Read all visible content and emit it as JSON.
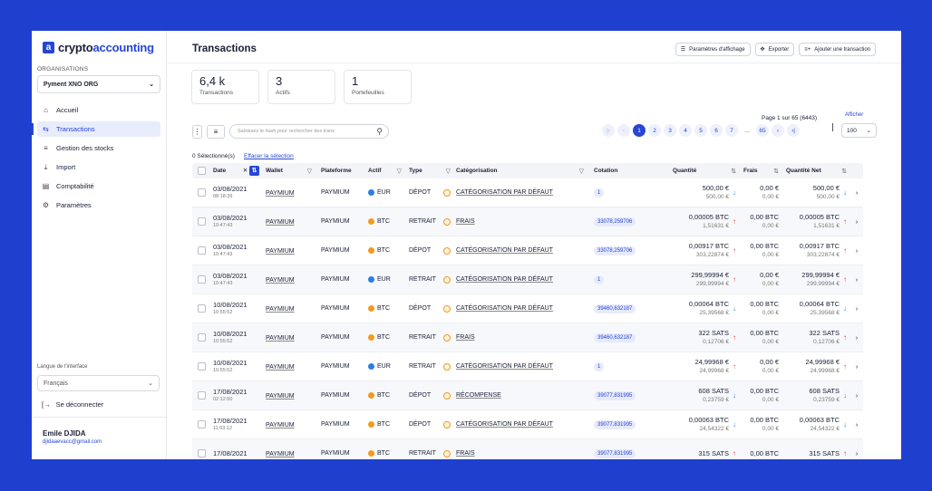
{
  "brand": {
    "logo_letter": "a",
    "name_prefix": "crypto",
    "name_suffix": "accounting",
    "accent": "#2746d6",
    "background": "#1f3fcf"
  },
  "sidebar": {
    "org_label": "ORGANISATIONS",
    "org_value": "Pyment XNO ORG",
    "items": [
      {
        "label": "Accueil",
        "icon": "home-icon",
        "glyph": "⌂",
        "active": false
      },
      {
        "label": "Transactions",
        "icon": "transactions-icon",
        "glyph": "⇆",
        "active": true
      },
      {
        "label": "Gestion des stocks",
        "icon": "stock-icon",
        "glyph": "≡",
        "active": false
      },
      {
        "label": "Import",
        "icon": "import-icon",
        "glyph": "⤓",
        "active": false
      },
      {
        "label": "Comptabilité",
        "icon": "document-icon",
        "glyph": "▤",
        "active": false
      },
      {
        "label": "Paramètres",
        "icon": "gear-icon",
        "glyph": "⚙",
        "active": false
      }
    ],
    "lang_label": "Langue de l'interface",
    "lang_value": "Français",
    "logout": "Se déconnecter",
    "user_name": "Emile DJIDA",
    "user_email": "djidaaevacc@gmail.com"
  },
  "header": {
    "title": "Transactions",
    "btn_display": "Paramètres d'affichage",
    "btn_export": "Exporter",
    "btn_add": "Ajouter une transaction"
  },
  "stats": [
    {
      "value": "6,4 k",
      "label": "Transactions"
    },
    {
      "value": "3",
      "label": "Actifs"
    },
    {
      "value": "1",
      "label": "Portefeuilles"
    }
  ],
  "toolbar": {
    "search_placeholder": "Saisissez le hash pour rechercher des trans"
  },
  "pager": {
    "pages": [
      "1",
      "2",
      "3",
      "4",
      "5",
      "6",
      "7",
      "...",
      "65"
    ],
    "current": "1",
    "info": "Page 1 sur 65 (6443)",
    "show_label": "Afficher",
    "show_value": "100"
  },
  "selection": {
    "count": "0 Sélectionné(s)",
    "clear": "Effacer la sélection"
  },
  "columns": {
    "date": "Date",
    "wallet": "Wallet",
    "platform": "Plateforme",
    "asset": "Actif",
    "type": "Type",
    "category": "Catégorisation",
    "quote": "Cotation",
    "qty": "Quantité",
    "fees": "Frais",
    "net": "Quantité Net"
  },
  "rows": [
    {
      "date": "03/08/2021",
      "time": "08:18:39",
      "wallet": "PAYMIUM",
      "platform": "PAYMIUM",
      "asset": "EUR",
      "coin": "eur",
      "type": "DÉPOT",
      "category": "CATÉGORISATION PAR DÉFAUT",
      "quote": "1",
      "qty": "500,00 €",
      "qty_sub": "500,00 €",
      "dir": "down",
      "fees": "0,00 €",
      "fees_sub": "0,00 €",
      "net": "500,00 €",
      "net_sub": "500,00 €"
    },
    {
      "date": "03/08/2021",
      "time": "10:47:43",
      "wallet": "PAYMIUM",
      "platform": "PAYMIUM",
      "asset": "BTC",
      "coin": "btc",
      "type": "RETRAIT",
      "category": "FRAIS",
      "quote": "33078,259706",
      "qty": "0,00005 BTC",
      "qty_sub": "1,51631 €",
      "dir": "up",
      "fees": "0,00 BTC",
      "fees_sub": "0,00 €",
      "net": "0,00005 BTC",
      "net_sub": "1,51631 €"
    },
    {
      "date": "03/08/2021",
      "time": "10:47:43",
      "wallet": "PAYMIUM",
      "platform": "PAYMIUM",
      "asset": "BTC",
      "coin": "btc",
      "type": "DÉPOT",
      "category": "CATÉGORISATION PAR DÉFAUT",
      "quote": "33078,259706",
      "qty": "0,00917 BTC",
      "qty_sub": "303,22874 €",
      "dir": "up",
      "fees": "0,00 BTC",
      "fees_sub": "0,00 €",
      "net": "0,00917 BTC",
      "net_sub": "303,22874 €"
    },
    {
      "date": "03/08/2021",
      "time": "10:47:43",
      "wallet": "PAYMIUM",
      "platform": "PAYMIUM",
      "asset": "EUR",
      "coin": "eur",
      "type": "RETRAIT",
      "category": "CATÉGORISATION PAR DÉFAUT",
      "quote": "1",
      "qty": "299,99994 €",
      "qty_sub": "299,99994 €",
      "dir": "up",
      "fees": "0,00 €",
      "fees_sub": "0,00 €",
      "net": "299,99994 €",
      "net_sub": "299,99994 €"
    },
    {
      "date": "10/08/2021",
      "time": "10:55:52",
      "wallet": "PAYMIUM",
      "platform": "PAYMIUM",
      "asset": "BTC",
      "coin": "btc",
      "type": "DÉPOT",
      "category": "CATÉGORISATION PAR DÉFAUT",
      "quote": "39460,632187",
      "qty": "0,00064 BTC",
      "qty_sub": "25,39568 €",
      "dir": "down",
      "fees": "0,00 BTC",
      "fees_sub": "0,00 €",
      "net": "0,00064 BTC",
      "net_sub": "25,39568 €"
    },
    {
      "date": "10/08/2021",
      "time": "10:55:52",
      "wallet": "PAYMIUM",
      "platform": "PAYMIUM",
      "asset": "BTC",
      "coin": "btc",
      "type": "RETRAIT",
      "category": "FRAIS",
      "quote": "39460,632187",
      "qty": "322 SATS",
      "qty_sub": "0,12706 €",
      "dir": "up",
      "fees": "0,00 BTC",
      "fees_sub": "0,00 €",
      "net": "322 SATS",
      "net_sub": "0,12706 €"
    },
    {
      "date": "10/08/2021",
      "time": "10:55:52",
      "wallet": "PAYMIUM",
      "platform": "PAYMIUM",
      "asset": "EUR",
      "coin": "eur",
      "type": "RETRAIT",
      "category": "CATÉGORISATION PAR DÉFAUT",
      "quote": "1",
      "qty": "24,99968 €",
      "qty_sub": "24,99968 €",
      "dir": "up",
      "fees": "0,00 €",
      "fees_sub": "0,00 €",
      "net": "24,99968 €",
      "net_sub": "24,99968 €"
    },
    {
      "date": "17/08/2021",
      "time": "02:12:50",
      "wallet": "PAYMIUM",
      "platform": "PAYMIUM",
      "asset": "BTC",
      "coin": "btc",
      "type": "DÉPOT",
      "category": "RÉCOMPENSE",
      "quote": "39077,831995",
      "qty": "608 SATS",
      "qty_sub": "0,23759 €",
      "dir": "down",
      "fees": "0,00 BTC",
      "fees_sub": "0,00 €",
      "net": "608 SATS",
      "net_sub": "0,23759 €"
    },
    {
      "date": "17/08/2021",
      "time": "11:03:12",
      "wallet": "PAYMIUM",
      "platform": "PAYMIUM",
      "asset": "BTC",
      "coin": "btc",
      "type": "DÉPOT",
      "category": "CATÉGORISATION PAR DÉFAUT",
      "quote": "39077,831995",
      "qty": "0,00063 BTC",
      "qty_sub": "24,54322 €",
      "dir": "down",
      "fees": "0,00 BTC",
      "fees_sub": "0,00 €",
      "net": "0,00063 BTC",
      "net_sub": "24,54322 €"
    },
    {
      "date": "17/08/2021",
      "time": "",
      "wallet": "PAYMIUM",
      "platform": "PAYMIUM",
      "asset": "BTC",
      "coin": "btc",
      "type": "RETRAIT",
      "category": "FRAIS",
      "quote": "39077,831995",
      "qty": "315 SATS",
      "qty_sub": "",
      "dir": "up",
      "fees": "0,00 BTC",
      "fees_sub": "",
      "net": "315 SATS",
      "net_sub": ""
    }
  ]
}
